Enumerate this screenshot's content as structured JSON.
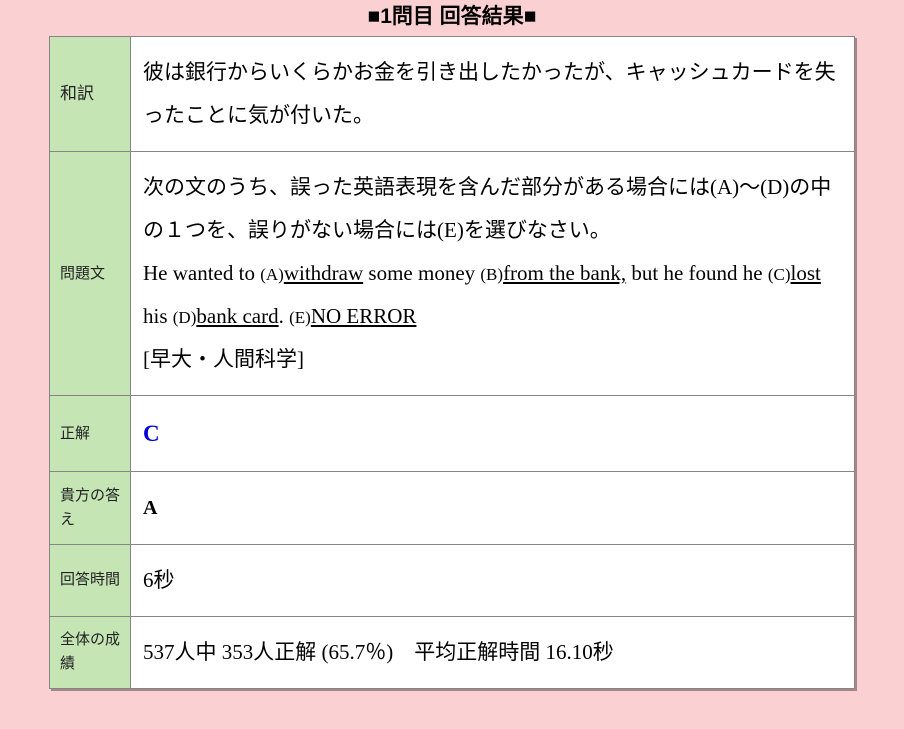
{
  "title": "■1問目 回答結果■",
  "rows": {
    "translation_label": "和訳",
    "translation": "彼は銀行からいくらかお金を引き出したかったが、キャッシュカードを失ったことに気が付いた。",
    "question_label": "問題文",
    "question_instr": "次の文のうち、誤った英語表現を含んだ部分がある場合には(A)〜(D)の中の１つを、誤りがない場合には(E)を選びなさい。",
    "sentence_pre": "He wanted to ",
    "tagA": "(A)",
    "partA": "withdraw",
    "mid1": " some money ",
    "tagB": "(B)",
    "partB": "from the bank,",
    "mid2": " but he found he ",
    "tagC": "(C)",
    "partC": "lost",
    "mid3": " his ",
    "tagD": "(D)",
    "partD": "bank card",
    "mid4": ". ",
    "tagE": "(E)",
    "partE": "NO ERROR",
    "source": "[早大・人間科学]",
    "correct_label": "正解",
    "correct": "C",
    "your_label": "貴方の答え",
    "your": "A",
    "time_label": "回答時間",
    "time": "6秒",
    "stats_label": "全体の成績",
    "stats": "537人中 353人正解 (65.7％)　平均正解時間 16.10秒"
  }
}
